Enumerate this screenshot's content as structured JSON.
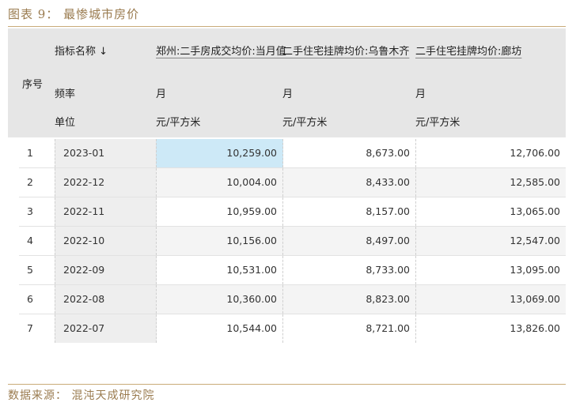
{
  "caption": "图表 9：  最惨城市房价",
  "source": "数据来源：  混沌天成研究院",
  "table": {
    "seq_header": "序号",
    "date_header": {
      "name": "指标名称 ↓",
      "freq": "频率",
      "unit": "单位"
    },
    "columns": [
      {
        "name": "郑州:二手房成交均价:当月值",
        "freq": "月",
        "unit": "元/平方米"
      },
      {
        "name": "二手住宅挂牌均价:乌鲁木齐",
        "freq": "月",
        "unit": "元/平方米"
      },
      {
        "name": "二手住宅挂牌均价:廊坊",
        "freq": "月",
        "unit": "元/平方米"
      }
    ],
    "rows": [
      {
        "seq": "1",
        "date": "2023-01",
        "v1": "10,259.00",
        "v2": "8,673.00",
        "v3": "12,706.00"
      },
      {
        "seq": "2",
        "date": "2022-12",
        "v1": "10,004.00",
        "v2": "8,433.00",
        "v3": "12,585.00"
      },
      {
        "seq": "3",
        "date": "2022-11",
        "v1": "10,959.00",
        "v2": "8,157.00",
        "v3": "13,065.00"
      },
      {
        "seq": "4",
        "date": "2022-10",
        "v1": "10,156.00",
        "v2": "8,497.00",
        "v3": "12,547.00"
      },
      {
        "seq": "5",
        "date": "2022-09",
        "v1": "10,531.00",
        "v2": "8,733.00",
        "v3": "13,095.00"
      },
      {
        "seq": "6",
        "date": "2022-08",
        "v1": "10,360.00",
        "v2": "8,823.00",
        "v3": "13,069.00"
      },
      {
        "seq": "7",
        "date": "2022-07",
        "v1": "10,544.00",
        "v2": "8,721.00",
        "v3": "13,826.00"
      }
    ]
  },
  "colors": {
    "selected_cell": "#cde9f7",
    "caption": "#9a7b4f",
    "rule": "#c9ab79"
  }
}
